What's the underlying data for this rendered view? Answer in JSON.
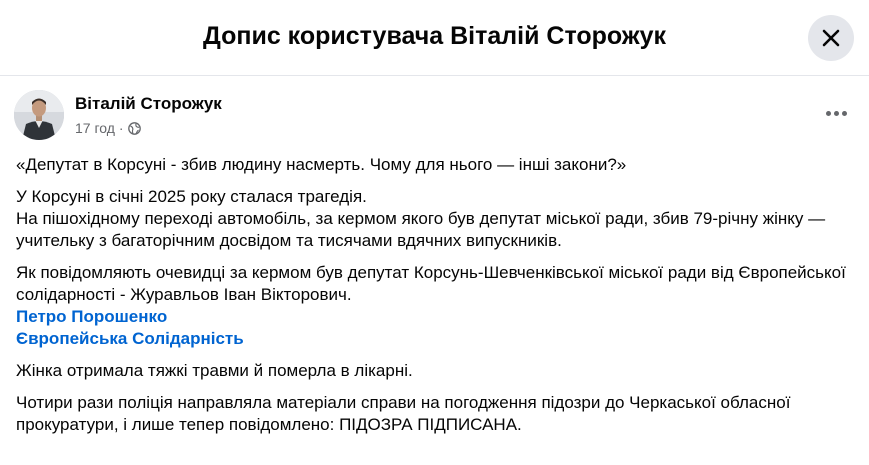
{
  "header": {
    "title": "Допис користувача Віталій Сторожук"
  },
  "author": {
    "name": "Віталій Сторожук",
    "time": "17 год",
    "separator": "·"
  },
  "icons": {
    "close": "close-icon",
    "globe": "globe-icon",
    "more": "more-horizontal-icon"
  },
  "colors": {
    "link": "#0064d1",
    "meta": "#65676b",
    "close_bg": "#e4e6eb"
  },
  "post": {
    "p1": "«Депутат в Корсуні - збив людину насмерть. Чому для нього — інші закони?»",
    "p2_line1": "У Корсуні в січні 2025 року сталася трагедія.",
    "p2_line2": "На пішохідному переході автомобіль, за кермом якого був депутат міської ради, збив 79-річну жінку — учительку з багаторічним досвідом та тисячами вдячних випускників.",
    "p3": "Як повідомляють очевидці за кермом був депутат Корсунь-Шевченківської міської ради від Європейської солідарності - Журавльов Іван Вікторович.",
    "link1": "Петро Порошенко",
    "link2": "Європейська Солідарність",
    "p4": "Жінка отримала тяжкі травми й померла в лікарні.",
    "p5": "Чотири рази поліція направляла матеріали справи на погодження підозри до Черкаської обласної прокуратури, і лише тепер повідомлено: ПІДОЗРА ПІДПИСАНА."
  }
}
